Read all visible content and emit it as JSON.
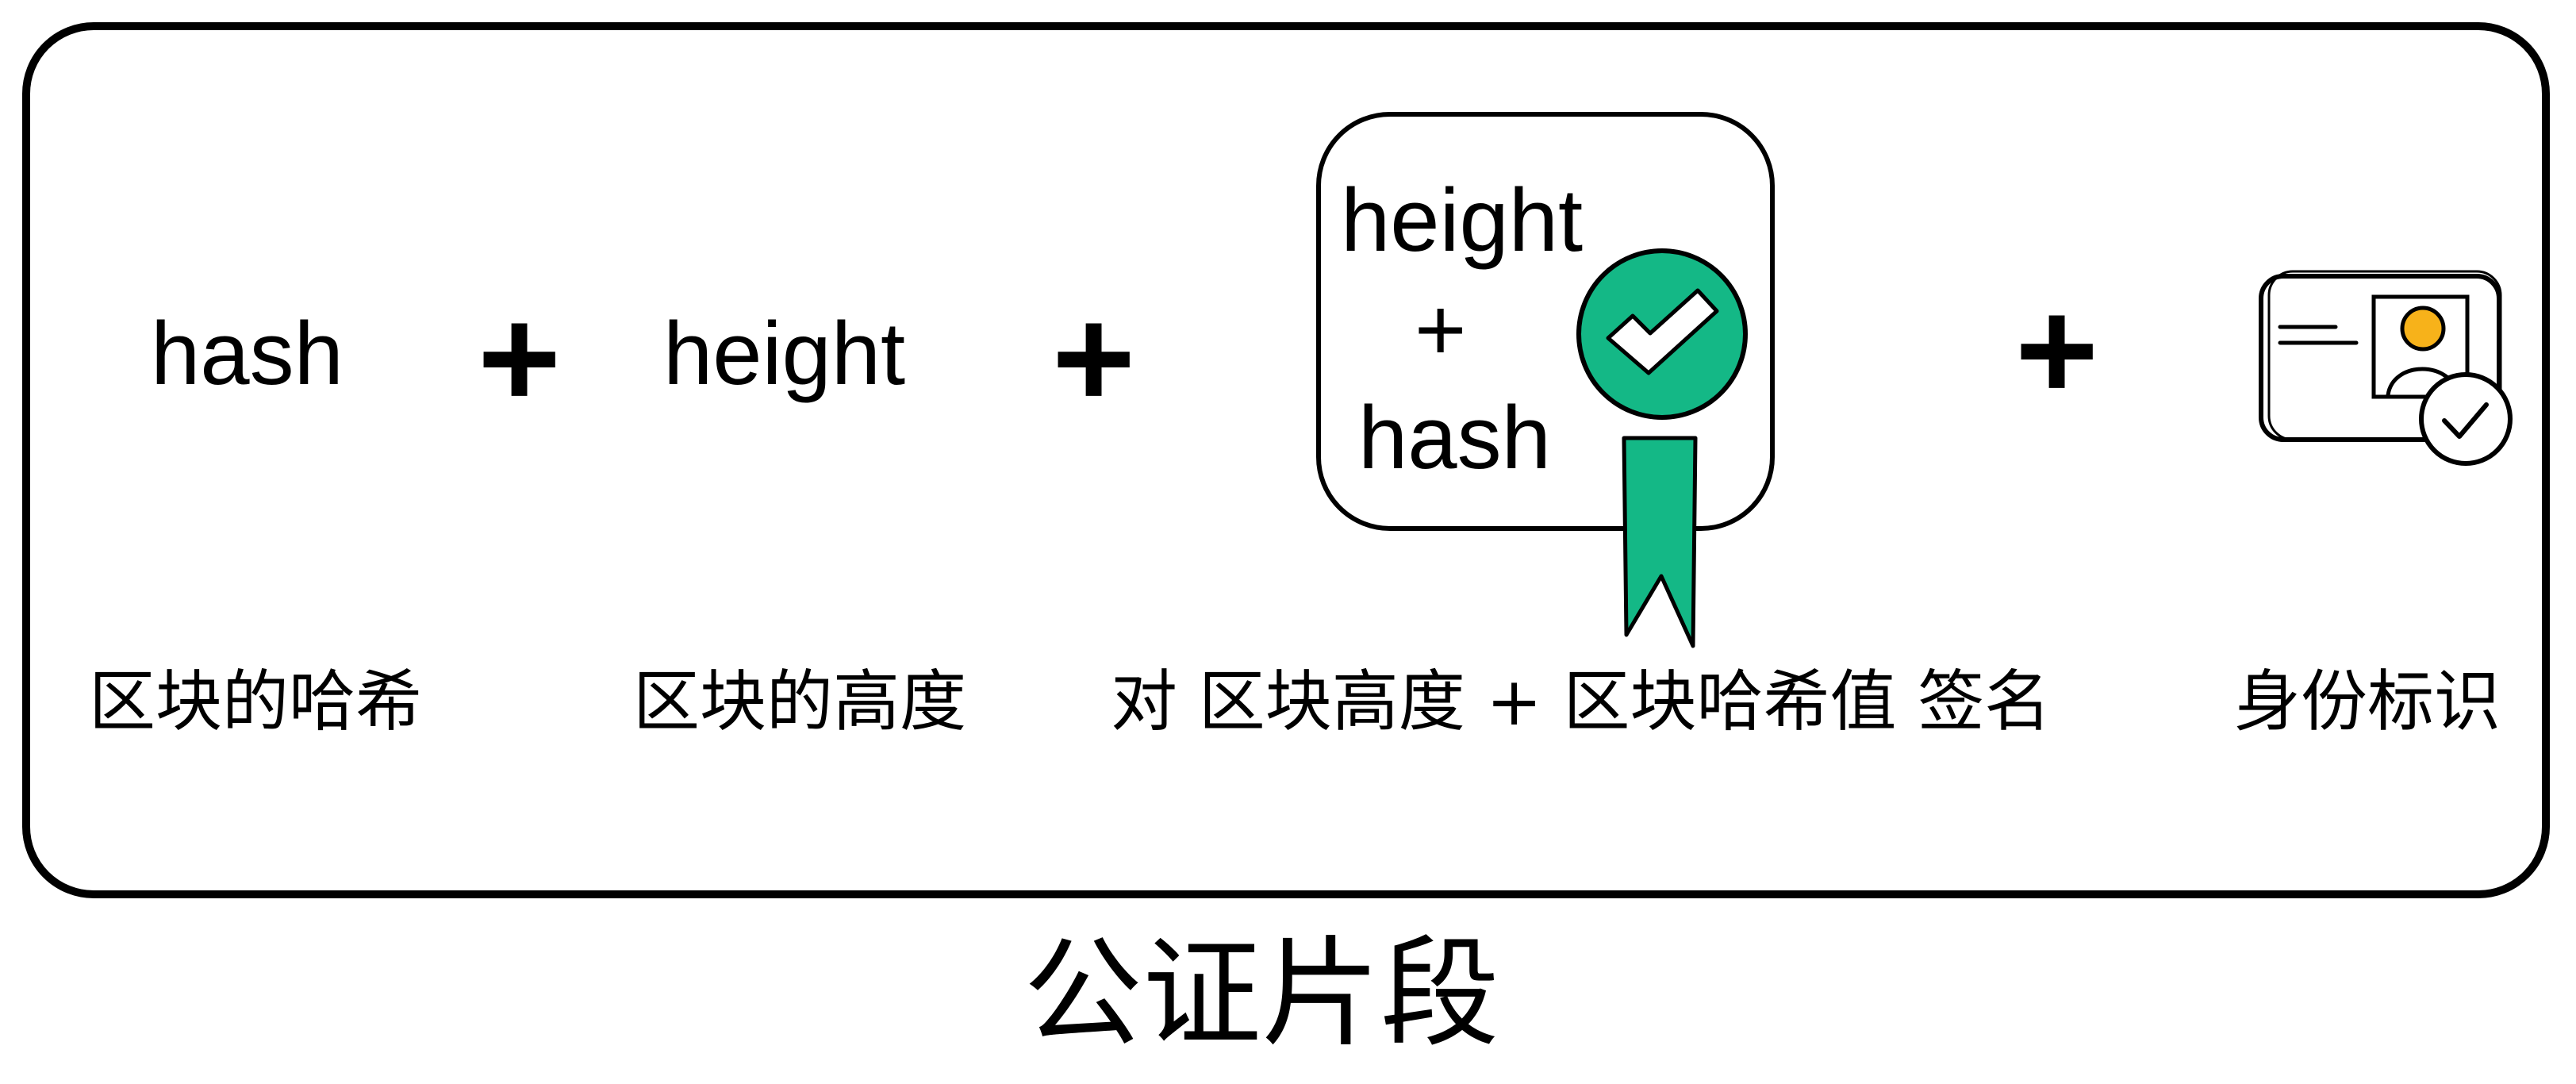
{
  "diagram": {
    "terms": {
      "hash": "hash",
      "height": "height"
    },
    "operators": {
      "plus": "+"
    },
    "certificate": {
      "line1": "height",
      "line2": "+",
      "line3": "hash"
    },
    "captions": {
      "block_hash": "区块的哈希",
      "block_height": "区块的高度",
      "signature": "对  区块高度 + 区块哈希值  签名",
      "identity": "身份标识"
    },
    "footer_title": "公证片段",
    "colors": {
      "badge_green": "#14b886",
      "avatar_orange": "#f7b21a",
      "stroke": "#000000"
    },
    "icons": [
      "certificate-icon",
      "check-badge-icon",
      "ribbon-icon",
      "id-card-icon",
      "verified-check-icon"
    ]
  }
}
